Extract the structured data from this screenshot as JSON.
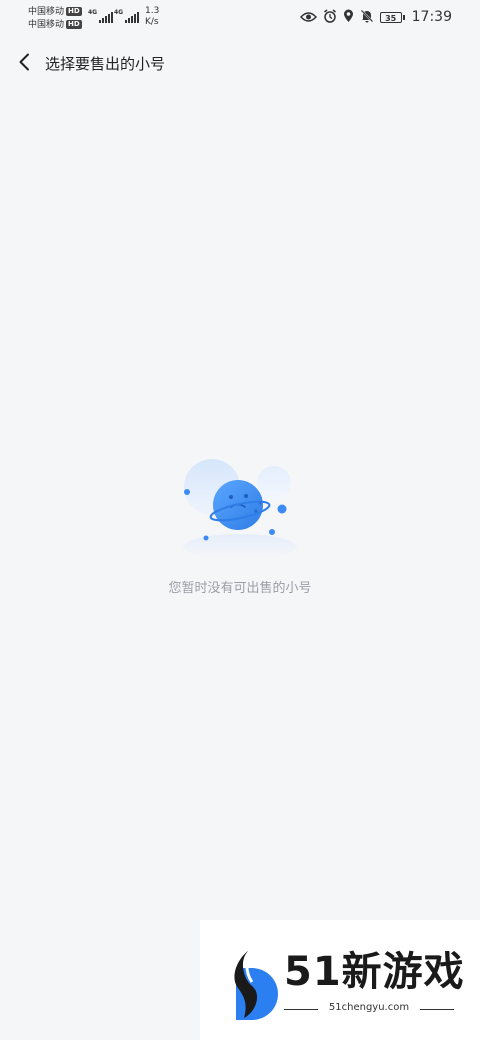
{
  "status_bar": {
    "carrier_1": "中国移动",
    "carrier_2": "中国移动",
    "hd_label_1": "HD",
    "hd_label_2": "HD",
    "network_1": "4G",
    "network_2": "4G",
    "speed_value": "1.3",
    "speed_unit": "K/s",
    "battery": "35",
    "time": "17:39",
    "icons": [
      "eye-icon",
      "alarm-icon",
      "location-icon",
      "mute-icon",
      "battery-icon"
    ]
  },
  "header": {
    "back_icon": "chevron-left-icon",
    "title": "选择要售出的小号"
  },
  "empty_state": {
    "illustration": "planet-illustration",
    "message": "您暂时没有可出售的小号",
    "accent_color": "#3d8bf2"
  },
  "watermark": {
    "brand": "51新游戏",
    "url": "51chengyu.com"
  }
}
